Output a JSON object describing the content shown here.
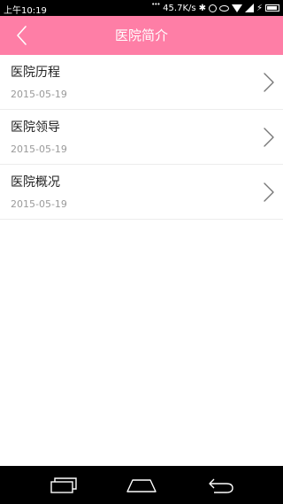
{
  "status_bar": {
    "time": "上午10:19",
    "speed": "45.7K/s"
  },
  "header": {
    "title": "医院简介"
  },
  "items": [
    {
      "title": "医院历程",
      "date": "2015-05-19"
    },
    {
      "title": "医院领导",
      "date": "2015-05-19"
    },
    {
      "title": "医院概况",
      "date": "2015-05-19"
    }
  ],
  "icons": {
    "back": "chevron-left-icon",
    "item_arrow": "chevron-right-icon",
    "nav": [
      "recent-apps-icon",
      "home-icon",
      "back-arrow-icon"
    ]
  },
  "colors": {
    "header": "#fe7ea6",
    "status_bar": "#000000",
    "nav_bar": "#000000"
  }
}
